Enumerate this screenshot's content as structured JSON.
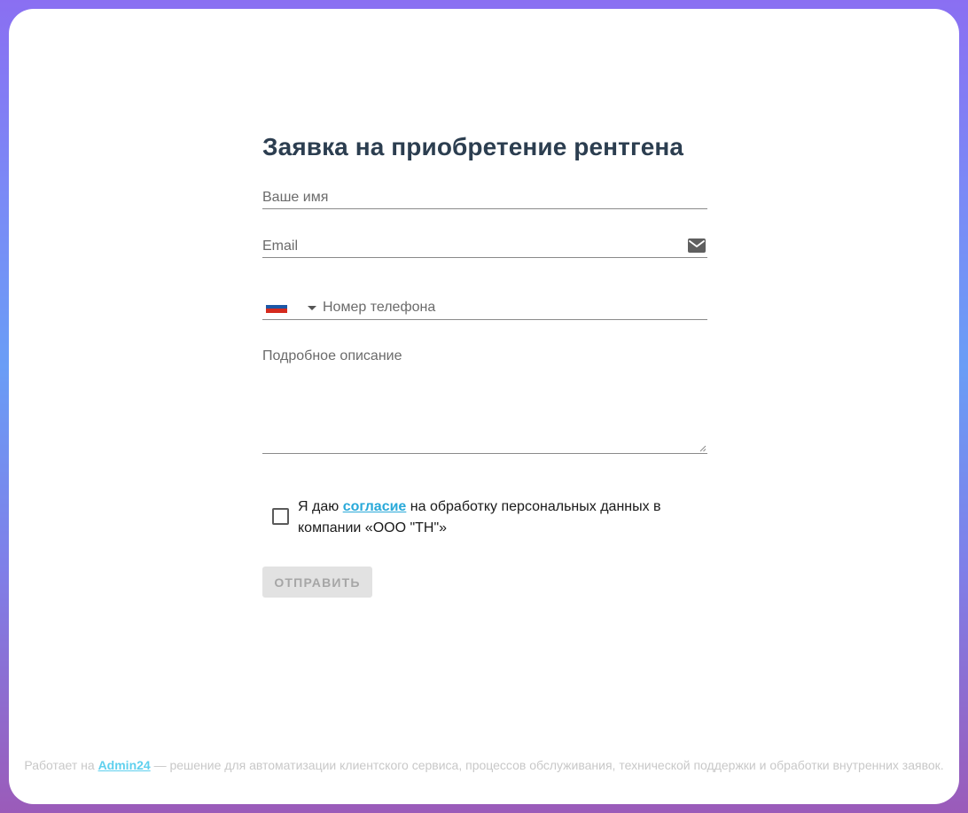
{
  "form": {
    "title": "Заявка на приобретение рентгена",
    "name_placeholder": "Ваше имя",
    "email_placeholder": "Email",
    "email_icon": "mail-icon",
    "phone": {
      "country_flag": "ru-flag",
      "flag_colors": [
        "#ffffff",
        "#1c57a6",
        "#d52b1e"
      ],
      "placeholder": "Номер телефона"
    },
    "description_placeholder": "Подробное описание",
    "consent": {
      "prefix": "Я даю ",
      "link_label": "согласие",
      "suffix": " на обработку персональных данных в компании «ООО \"ТН\"»",
      "checked": false
    },
    "submit_label": "ОТПРАВИТЬ"
  },
  "footer": {
    "prefix": "Работает на ",
    "link_label": "Admin24",
    "suffix": " — решение для автоматизации клиентского сервиса, процессов обслуживания, технической поддержки и обработки внутренних заявок."
  },
  "colors": {
    "title": "#2c3e50",
    "link": "#29a9d9",
    "footer_link": "#5fd0ee",
    "button_bg": "#e2e2e2",
    "button_text": "#a6a6a6"
  }
}
